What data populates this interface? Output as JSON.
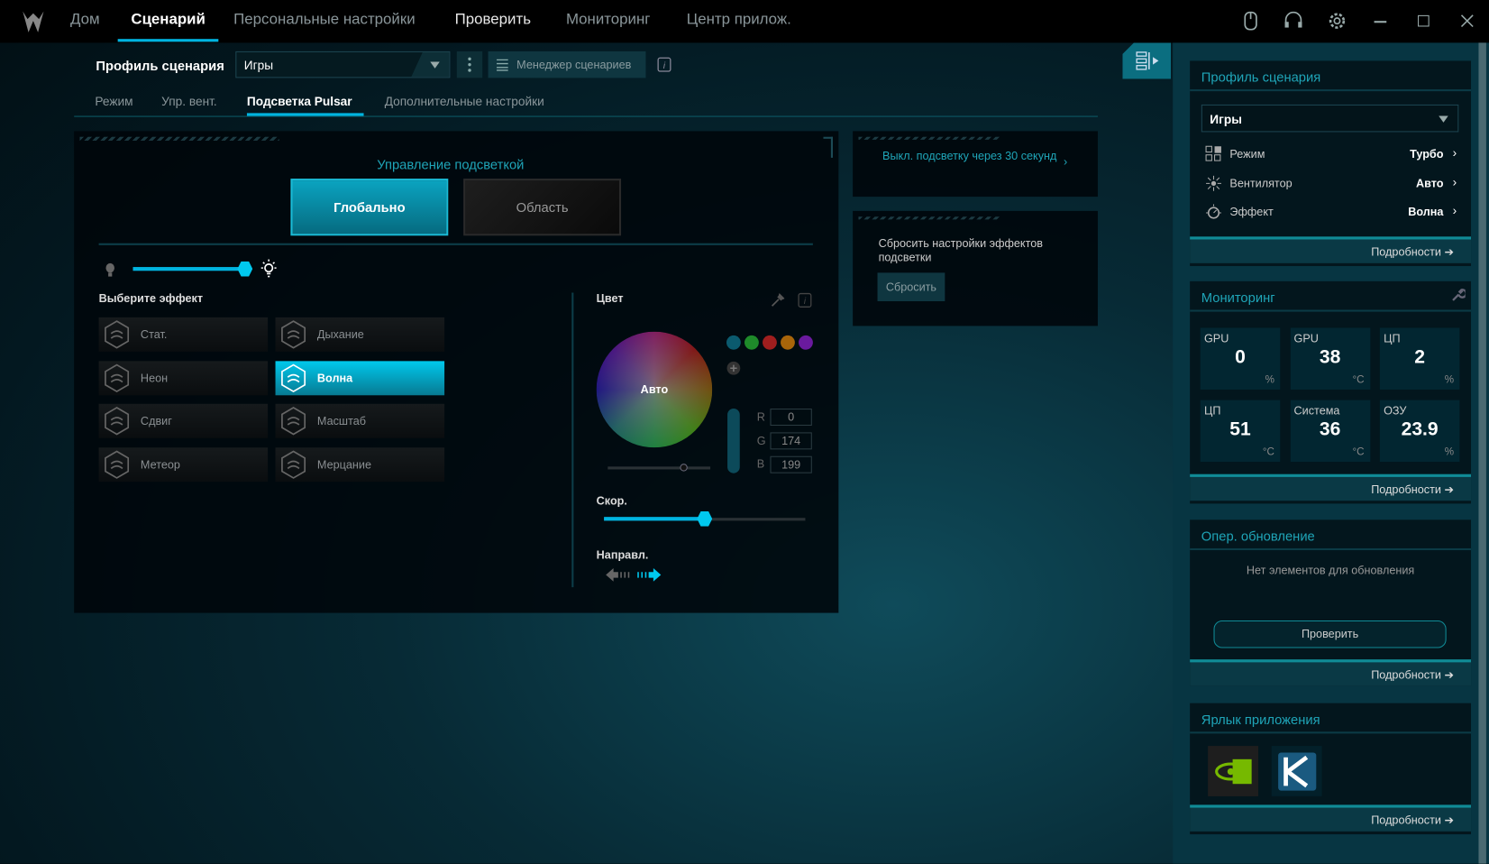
{
  "nav": {
    "items": [
      "Дом",
      "Сценарий",
      "Персональные настройки",
      "Проверить",
      "Мониторинг",
      "Центр прилож."
    ],
    "active": 1
  },
  "profile_bar": {
    "label": "Профиль сценария",
    "value": "Игры",
    "manager": "Менеджер сценариев"
  },
  "subtabs": [
    "Режим",
    "Упр. вент.",
    "Подсветка Pulsar",
    "Дополнительные настройки"
  ],
  "lighting": {
    "title": "Управление подсветкой",
    "global": "Глобально",
    "zone": "Область",
    "brightness_percent": 100,
    "select_effect": "Выберите эффект",
    "effects": [
      "Стат.",
      "Дыхание",
      "Неон",
      "Волна",
      "Сдвиг",
      "Масштаб",
      "Метеор",
      "Мерцание"
    ],
    "selected_effect": "Волна",
    "color_label": "Цвет",
    "wheel_label": "Авто",
    "swatches": [
      "#0b5a6e",
      "#1e8a2a",
      "#a01e1e",
      "#a8650a",
      "#6a1a9e"
    ],
    "rgb": {
      "r_label": "R",
      "g_label": "G",
      "b_label": "B",
      "r": "0",
      "g": "174",
      "b": "199"
    },
    "speed_label": "Скор.",
    "speed_percent": 50,
    "direction_label": "Направл.",
    "direction": "right"
  },
  "side_cards": {
    "timeout": "Выкл. подсветку через 30 секунд",
    "reset_text": "Сбросить настройки эффектов подсветки",
    "reset_btn": "Сбросить"
  },
  "right": {
    "profile": {
      "title": "Профиль сценария",
      "value": "Игры",
      "rows": [
        {
          "label": "Режим",
          "value": "Турбо"
        },
        {
          "label": "Вентилятор",
          "value": "Авто"
        },
        {
          "label": "Эффект",
          "value": "Волна"
        }
      ],
      "more": "Подробности"
    },
    "monitoring": {
      "title": "Мониторинг",
      "tiles": [
        {
          "t": "GPU",
          "v": "0",
          "u": "%"
        },
        {
          "t": "GPU",
          "v": "38",
          "u": "°C"
        },
        {
          "t": "ЦП",
          "v": "2",
          "u": "%"
        },
        {
          "t": "ЦП",
          "v": "51",
          "u": "°C"
        },
        {
          "t": "Система",
          "v": "36",
          "u": "°C"
        },
        {
          "t": "ОЗУ",
          "v": "23.9",
          "u": "%"
        }
      ],
      "more": "Подробности"
    },
    "update": {
      "title": "Опер. обновление",
      "text": "Нет элементов для обновления",
      "button": "Проверить",
      "more": "Подробности"
    },
    "shortcut": {
      "title": "Ярлык приложения",
      "more": "Подробности"
    }
  },
  "colors": {
    "accent": "#00b4e0",
    "teal_text": "#1fa5b8"
  }
}
